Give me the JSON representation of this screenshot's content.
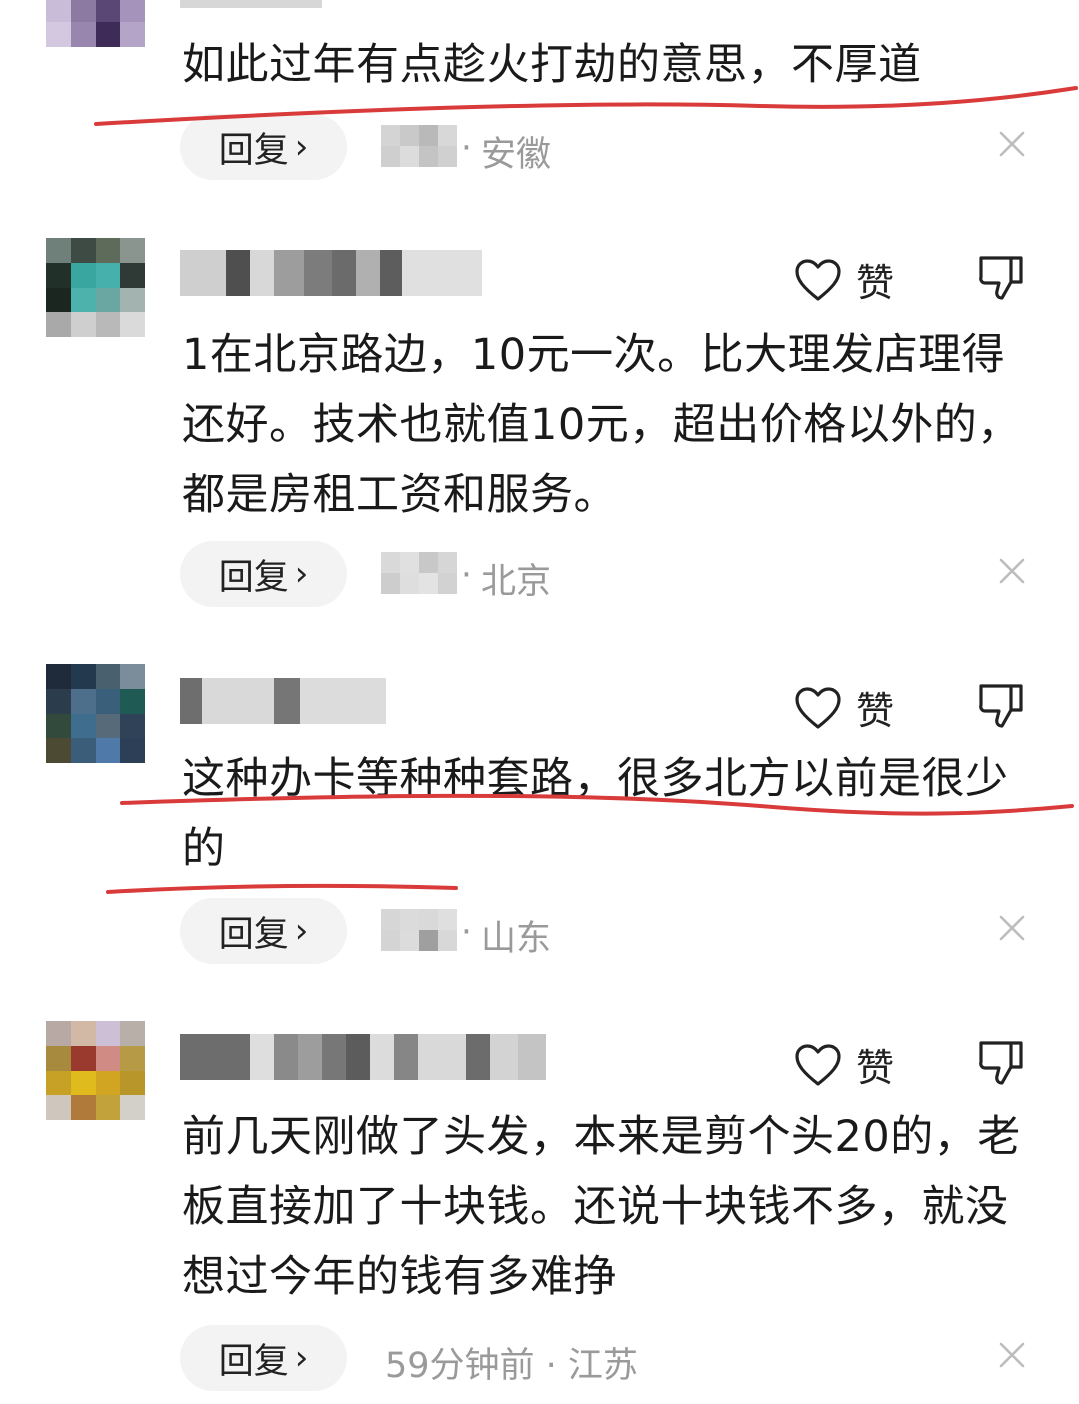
{
  "icons": {
    "like": "heart-outline-icon",
    "dislike": "thumbs-down-outline-icon",
    "reply_chevron": "chevron-right-icon",
    "close": "close-icon"
  },
  "colors": {
    "text": "#1a1a1a",
    "meta": "#9a9a9a",
    "reply_bg": "#f3f3f3",
    "annotation": "#d93a3a"
  },
  "comments": [
    {
      "body": "如此过年有点趁火打劫的意思，不厚道",
      "reply_label": "回复",
      "separator": "·",
      "location": "安徽"
    },
    {
      "like_label": "赞",
      "body": "1在北京路边，10元一次。比大理发店理得还好。技术也就值10元，超出价格以外的，都是房租工资和服务。",
      "reply_label": "回复",
      "separator": "·",
      "location": "北京"
    },
    {
      "like_label": "赞",
      "body": "这种办卡等种种套路，很多北方以前是很少的",
      "reply_label": "回复",
      "separator": "·",
      "location": "山东"
    },
    {
      "like_label": "赞",
      "body": "前几天刚做了头发，本来是剪个头20的，老板直接加了十块钱。还说十块钱不多，就没想过今年的钱有多难挣",
      "reply_label": "回复",
      "meta_text": "59分钟前 · 江苏"
    }
  ]
}
